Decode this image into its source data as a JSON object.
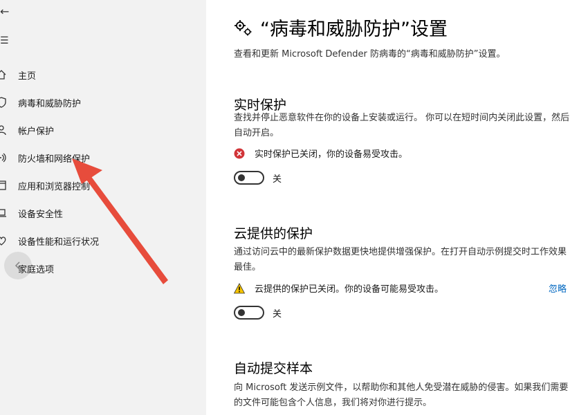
{
  "sidebar": {
    "back_symbol": "←",
    "menu_symbol": "☰",
    "items": [
      {
        "label": "主页",
        "icon": "home-icon"
      },
      {
        "label": "病毒和威胁防护",
        "icon": "shield-icon"
      },
      {
        "label": "帐户保护",
        "icon": "person-icon"
      },
      {
        "label": "防火墙和网络保护",
        "icon": "wifi-icon"
      },
      {
        "label": "应用和浏览器控制",
        "icon": "app-window-icon"
      },
      {
        "label": "设备安全性",
        "icon": "laptop-icon"
      },
      {
        "label": "设备性能和运行状况",
        "icon": "heart-icon"
      },
      {
        "label": "家庭选项",
        "icon": "family-icon"
      }
    ]
  },
  "main": {
    "title": "“病毒和威胁防护”设置",
    "subtitle": "查看和更新 Microsoft Defender 防病毒的“病毒和威胁防护”设置。",
    "sections": {
      "realtime": {
        "title": "实时保护",
        "desc": "查找并停止恶意软件在你的设备上安装或运行。 你可以在短时间内关闭此设置，然后自动开启。",
        "status": "实时保护已关闭，你的设备易受攻击。",
        "toggle_label": "关"
      },
      "cloud": {
        "title": "云提供的保护",
        "desc": "通过访问云中的最新保护数据更快地提供增强保护。在打开自动示例提交时工作效果最佳。",
        "status": "云提供的保护已关闭。你的设备可能易受攻击。",
        "dismiss": "忽略",
        "toggle_label": "关"
      },
      "sample": {
        "title": "自动提交样本",
        "desc": "向 Microsoft 发送示例文件，以帮助你和其他人免受潜在威胁的侵害。如果我们需要的文件可能包含个人信息，我们将对你进行提示。"
      }
    }
  },
  "colors": {
    "sidebar_bg": "#f2f2f2",
    "error_red": "#d13438",
    "warning_yellow": "#f7c400",
    "link_blue": "#0067c0",
    "annotation_red": "#e74c3c"
  }
}
